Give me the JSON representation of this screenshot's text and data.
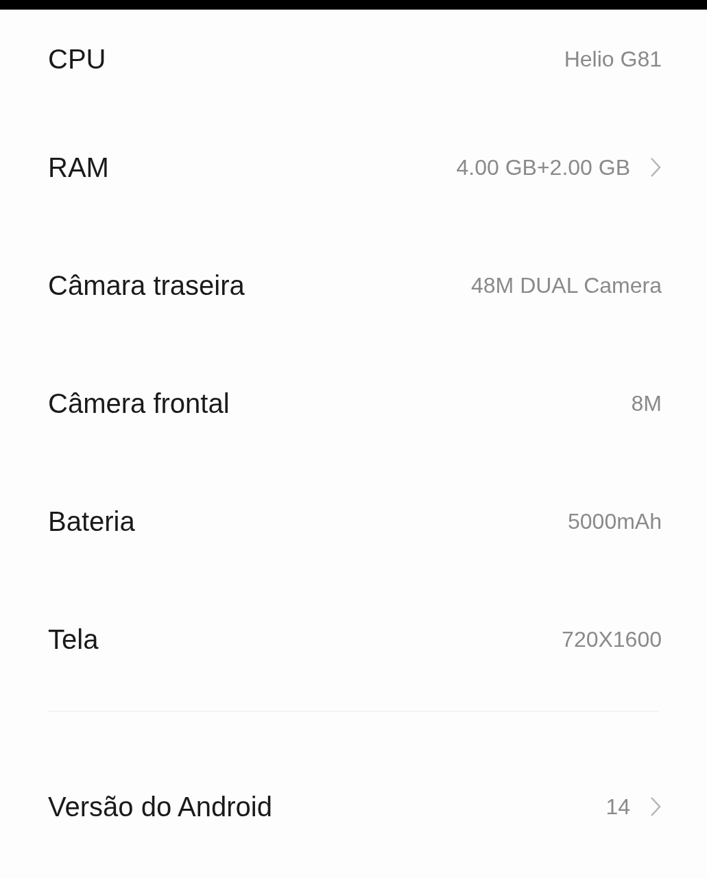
{
  "sections": [
    {
      "rows": [
        {
          "label": "CPU",
          "value": "Helio G81",
          "has_arrow": false
        },
        {
          "label": "RAM",
          "value": "4.00 GB+2.00 GB",
          "has_arrow": true
        },
        {
          "label": "Câmara traseira",
          "value": "48M DUAL Camera",
          "has_arrow": false
        },
        {
          "label": "Câmera frontal",
          "value": "8M",
          "has_arrow": false
        },
        {
          "label": "Bateria",
          "value": "5000mAh",
          "has_arrow": false
        },
        {
          "label": "Tela",
          "value": "720X1600",
          "has_arrow": false
        }
      ]
    },
    {
      "rows": [
        {
          "label": "Versão do Android",
          "value": "14",
          "has_arrow": true
        }
      ]
    }
  ]
}
